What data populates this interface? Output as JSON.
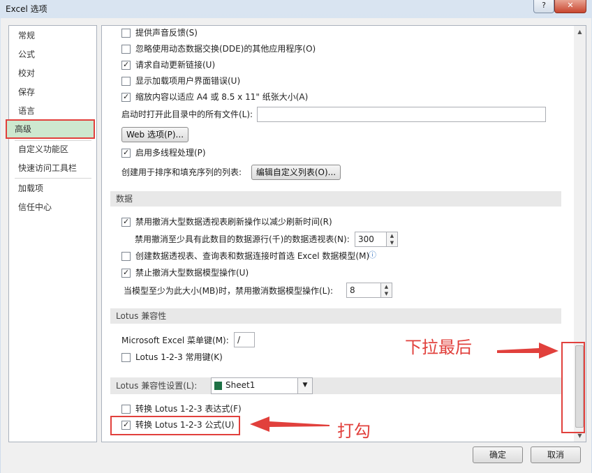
{
  "window": {
    "title": "Excel 选项",
    "help_label": "?",
    "close_label": "✕"
  },
  "nav": {
    "items": [
      {
        "label": "常规"
      },
      {
        "label": "公式"
      },
      {
        "label": "校对"
      },
      {
        "label": "保存"
      },
      {
        "label": "语言"
      },
      {
        "label": "高级",
        "selected": true
      },
      {
        "label": "自定义功能区"
      },
      {
        "label": "快速访问工具栏"
      },
      {
        "label": "加载项"
      },
      {
        "label": "信任中心"
      }
    ]
  },
  "general": {
    "provide_sound": {
      "label": "提供声音反馈(S)",
      "checked": false
    },
    "ignore_dde": {
      "label": "忽略使用动态数据交换(DDE)的其他应用程序(O)",
      "checked": false
    },
    "update_links": {
      "label": "请求自动更新链接(U)",
      "checked": true
    },
    "addin_errors": {
      "label": "显示加载项用户界面错误(U)",
      "checked": false
    },
    "scale_content": {
      "label": "缩放内容以适应 A4 或 8.5 x 11\" 纸张大小(A)",
      "checked": true
    },
    "startup_open_label": "启动时打开此目录中的所有文件(L):",
    "startup_open_value": "",
    "web_options_button": "Web 选项(P)...",
    "multithread": {
      "label": "启用多线程处理(P)",
      "checked": true
    },
    "custom_list_label": "创建用于排序和填充序列的列表:",
    "edit_custom_lists_button": "编辑自定义列表(O)..."
  },
  "data_section": {
    "title": "数据",
    "disable_undo_pivot": {
      "label": "禁用撤消大型数据透视表刷新操作以减少刷新时间(R)",
      "checked": true
    },
    "pivot_rows_label": "禁用撤消至少具有此数目的数据源行(千)的数据透视表(N):",
    "pivot_rows_value": "300",
    "prefer_data_model": {
      "label": "创建数据透视表、查询表和数据连接时首选 Excel 数据模型(M)",
      "checked": false
    },
    "info_icon": "ⓘ",
    "disable_undo_model": {
      "label": "禁止撤消大型数据模型操作(U)",
      "checked": true
    },
    "model_size_label": "当模型至少为此大小(MB)时，禁用撤消数据模型操作(L):",
    "model_size_value": "8"
  },
  "lotus_section": {
    "title": "Lotus 兼容性",
    "menu_key_label": "Microsoft Excel 菜单键(M):",
    "menu_key_value": "/",
    "nav_keys": {
      "label": "Lotus 1-2-3 常用键(K)",
      "checked": false
    }
  },
  "lotus_settings": {
    "title": "Lotus 兼容性设置(L):",
    "sheet_value": "Sheet1",
    "transition_eval": {
      "label": "转换 Lotus 1-2-3 表达式(F)",
      "checked": false
    },
    "transition_formula": {
      "label": "转换 Lotus 1-2-3 公式(U)",
      "checked": true
    }
  },
  "annotations": {
    "scroll_note": "下拉最后",
    "check_note": "打勾",
    "color": "#e1403c"
  },
  "footer": {
    "ok_label": "确定",
    "cancel_label": "取消"
  }
}
